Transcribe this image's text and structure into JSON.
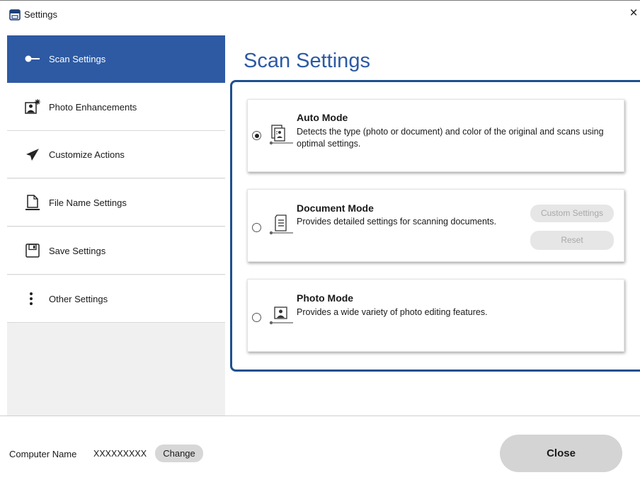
{
  "window": {
    "title": "Settings",
    "close_glyph": "×",
    "app_icon": "settings-window-icon"
  },
  "sidebar": {
    "items": [
      {
        "label": "Scan Settings",
        "icon": "scan-settings-icon",
        "active": true
      },
      {
        "label": "Photo Enhancements",
        "icon": "photo-enhancements-icon",
        "active": false
      },
      {
        "label": "Customize Actions",
        "icon": "paper-plane-icon",
        "active": false
      },
      {
        "label": "File Name Settings",
        "icon": "file-name-icon",
        "active": false
      },
      {
        "label": "Save Settings",
        "icon": "floppy-disk-icon",
        "active": false
      },
      {
        "label": "Other Settings",
        "icon": "vertical-ellipsis-icon",
        "active": false
      }
    ]
  },
  "main": {
    "title": "Scan Settings",
    "modes": [
      {
        "title": "Auto Mode",
        "description": "Detects the type (photo or document) and color of the original and scans using optimal settings.",
        "selected": true,
        "icon": "auto-mode-icon"
      },
      {
        "title": "Document Mode",
        "description": "Provides detailed settings for scanning documents.",
        "selected": false,
        "icon": "document-mode-icon",
        "buttons": {
          "custom": "Custom Settings",
          "reset": "Reset"
        }
      },
      {
        "title": "Photo Mode",
        "description": "Provides a wide variety of photo editing features.",
        "selected": false,
        "icon": "photo-mode-icon"
      }
    ]
  },
  "footer": {
    "computer_name_label": "Computer Name",
    "computer_name_value": "XXXXXXXXX",
    "change_label": "Change",
    "close_label": "Close"
  },
  "colors": {
    "accent": "#2d5aa3",
    "focus_border": "#1e4f8f",
    "sidebar_bg": "#f0f0f0"
  }
}
